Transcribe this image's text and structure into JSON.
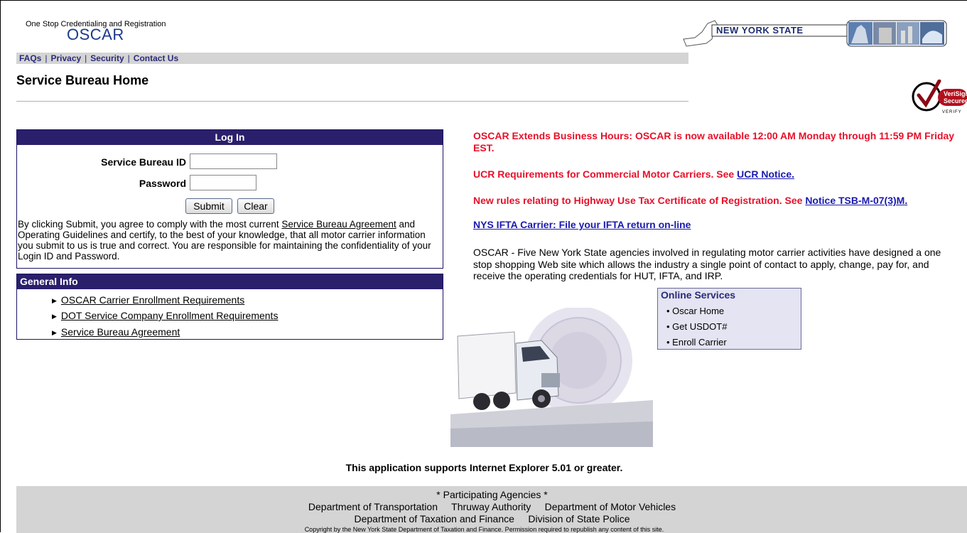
{
  "header": {
    "logo_small": "One Stop Credentialing and Registration",
    "logo_big": "OSCAR",
    "nav": [
      "FAQs",
      "Privacy",
      "Security",
      "Contact Us"
    ],
    "page_title": "Service Bureau Home",
    "nys_banner": "NEW YORK STATE",
    "verisign": {
      "line1": "VeriSign",
      "line2": "Secured",
      "verify": "VERIFY"
    }
  },
  "login": {
    "heading": "Log In",
    "id_label": "Service Bureau ID",
    "id_value": "",
    "password_label": "Password",
    "password_value": "",
    "submit_label": "Submit",
    "clear_label": "Clear",
    "agree_before": "By clicking Submit, you agree to comply with the most current ",
    "agree_link": "Service Bureau Agreement",
    "agree_after": " and Operating Guidelines and certify, to the best of your knowledge, that all motor carrier information you submit to us is true and correct. You are responsible for maintaining the confidentiality of your Login ID and Password."
  },
  "general_info": {
    "heading": "General Info",
    "items": [
      "OSCAR Carrier Enrollment Requirements",
      "DOT Service Company Enrollment Requirements",
      "Service Bureau Agreement"
    ]
  },
  "notices": {
    "hours": "OSCAR Extends Business Hours: OSCAR is now available 12:00 AM Monday through 11:59 PM Friday EST.",
    "ucr_text": "UCR Requirements for Commercial Motor Carriers. See ",
    "ucr_link": "UCR Notice.",
    "hut_text": "New rules relating to Highway Use Tax Certificate of Registration. See ",
    "hut_link": "Notice TSB-M-07(3)M.",
    "ifta_link": "NYS IFTA Carrier: File your IFTA return on-line",
    "description": "OSCAR - Five New York State agencies involved in regulating motor carrier activities have designed a one stop shopping Web site which allows the industry a single point of contact to apply, change, pay for, and receive the operating credentials for HUT, IFTA, and IRP."
  },
  "online_services": {
    "title": "Online Services",
    "items": [
      "Oscar Home",
      "Get USDOT#",
      "Enroll Carrier"
    ]
  },
  "footer": {
    "ie_note": "This application supports Internet Explorer 5.01 or greater.",
    "agencies_title": "* Participating Agencies *",
    "agencies_line1": "Department of Transportation     Thruway Authority     Department of Motor Vehicles",
    "agencies_line2": "Department of Taxation and Finance     Division of State Police",
    "copyright": "Copyright by the New York State Department of Taxation and Finance.  Permission required to republish any content of this site."
  },
  "colors": {
    "nav_bg": "#d4d4d4",
    "panel_header": "#2a1f6b",
    "notice_red": "#e8102a",
    "link_blue": "#1a1ab0"
  }
}
